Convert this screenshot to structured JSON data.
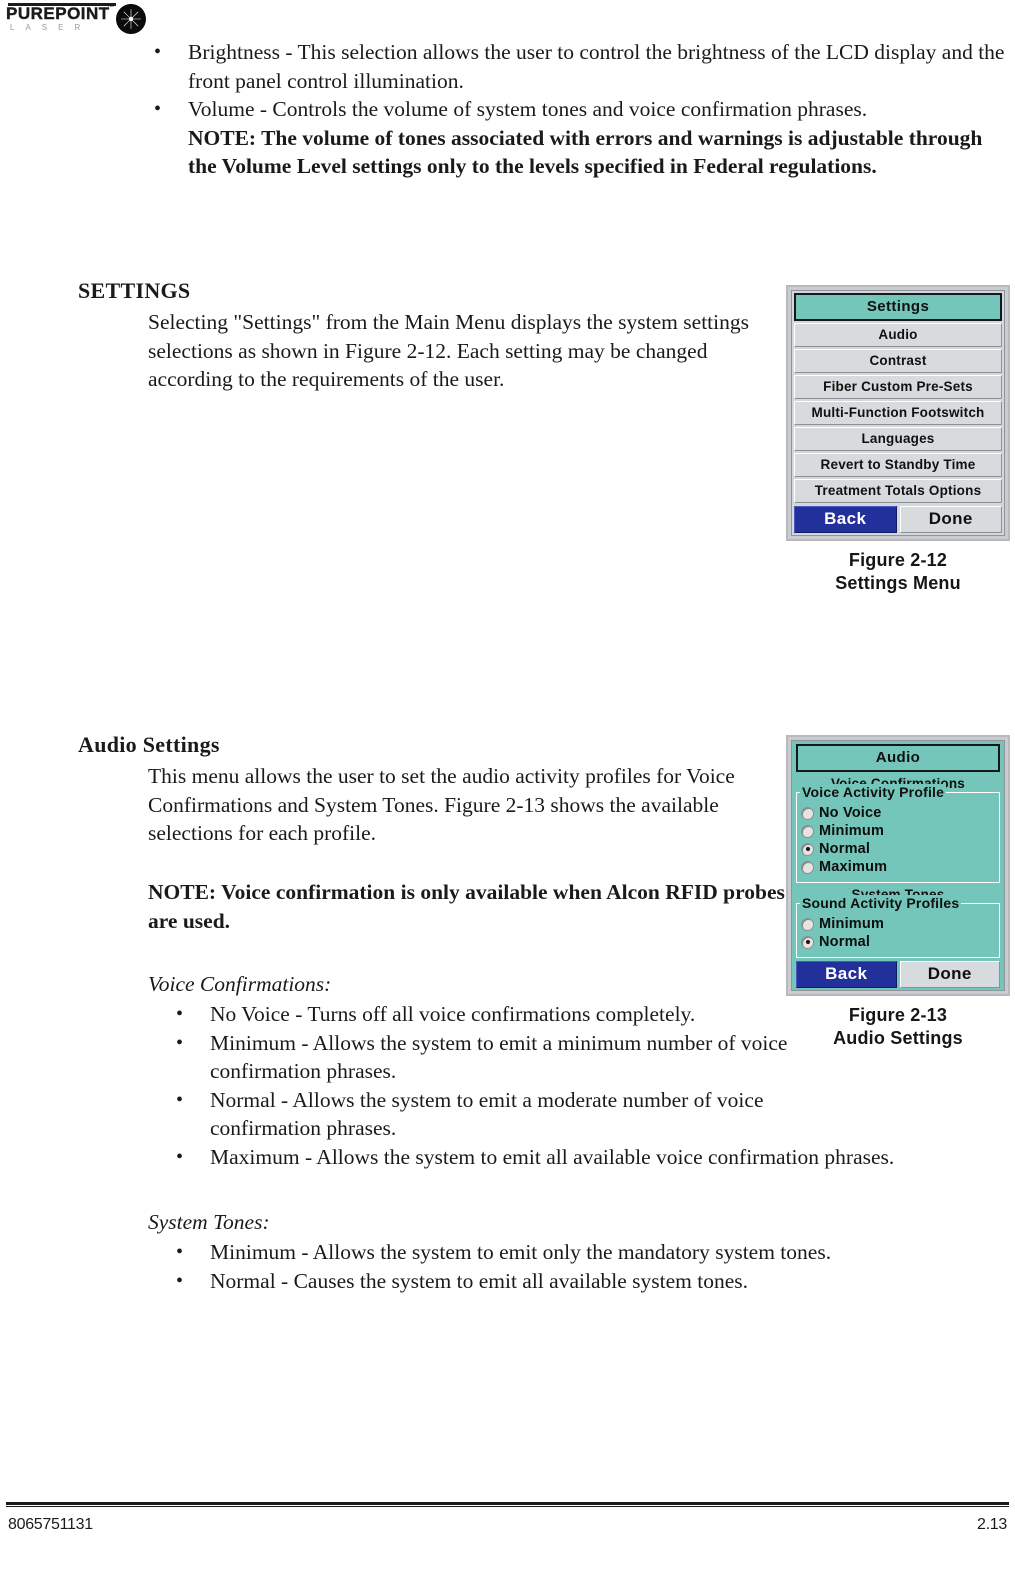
{
  "logo": {
    "wordmark": "PUREPOINT",
    "trademark": "™",
    "subtext": "LASER",
    "icon": "starburst-orb-icon"
  },
  "intro_bullets": [
    {
      "text": "Brightness - This selection allows the user to control the brightness of the LCD display and the front panel control illumination.",
      "note": ""
    },
    {
      "text": "Volume - Controls the volume of system tones and voice confirmation phrases. ",
      "note": "NOTE: The volume of tones associated with errors and warnings is adjustable through the Volume Level settings only to the levels specified in Federal regulations."
    }
  ],
  "settings_section": {
    "heading": "SETTINGS",
    "paragraph": "Selecting \"Settings\" from the Main Menu displays the system settings selections as shown in Figure 2-12. Each setting may be changed according to the requirements of the user."
  },
  "figure_2_12": {
    "title": "Settings",
    "menu_items": [
      "Audio",
      "Contrast",
      "Fiber Custom Pre-Sets",
      "Multi-Function Footswitch",
      "Languages",
      "Revert to Standby Time",
      "Treatment Totals Options"
    ],
    "back_label": "Back",
    "done_label": "Done",
    "caption_line1": "Figure 2-12",
    "caption_line2": "Settings Menu",
    "colors": {
      "title_bg": "#74c6ba",
      "item_bg": "#d8dbdd",
      "back_bg": "#22309c",
      "panel_bg": "#c9cdd1"
    }
  },
  "audio_section": {
    "heading": "Audio Settings",
    "paragraph": "This menu allows the user to set the audio activity profiles for Voice Confirmations and System Tones. Figure 2-13 shows the available selections for each profile.",
    "note": "NOTE: Voice confirmation is only available when Alcon RFID probes are used.",
    "voice_confirmations_title": "Voice Confirmations:",
    "voice_confirmations_bullets": [
      "No Voice - Turns off all voice confirmations completely.",
      "Minimum - Allows the system to emit a minimum number of voice confirmation phrases.",
      "Normal - Allows the system to emit a moderate number of voice confirmation phrases.",
      "Maximum - Allows the system to emit all available voice confirmation phrases."
    ],
    "system_tones_title": "System Tones:",
    "system_tones_bullets": [
      "Minimum - Allows the system to emit only the mandatory system tones.",
      "Normal - Causes the system to emit all available system tones."
    ]
  },
  "figure_2_13": {
    "title": "Audio",
    "group1_label": "Voice Confirmations",
    "group1_legend": "Voice Activity Profile",
    "group1_options": [
      {
        "label": "No Voice",
        "selected": false
      },
      {
        "label": "Minimum",
        "selected": false
      },
      {
        "label": "Normal",
        "selected": true
      },
      {
        "label": "Maximum",
        "selected": false
      }
    ],
    "group2_label": "System Tones",
    "group2_legend": "Sound Activity Profiles",
    "group2_options": [
      {
        "label": "Minimum",
        "selected": false
      },
      {
        "label": "Normal",
        "selected": true
      }
    ],
    "back_label": "Back",
    "done_label": "Done",
    "caption_line1": "Figure 2-13",
    "caption_line2": "Audio Settings",
    "colors": {
      "panel_bg": "#74c6ba",
      "back_bg": "#22309c"
    }
  },
  "footer": {
    "doc_number": "8065751131",
    "page_number": "2.13"
  }
}
